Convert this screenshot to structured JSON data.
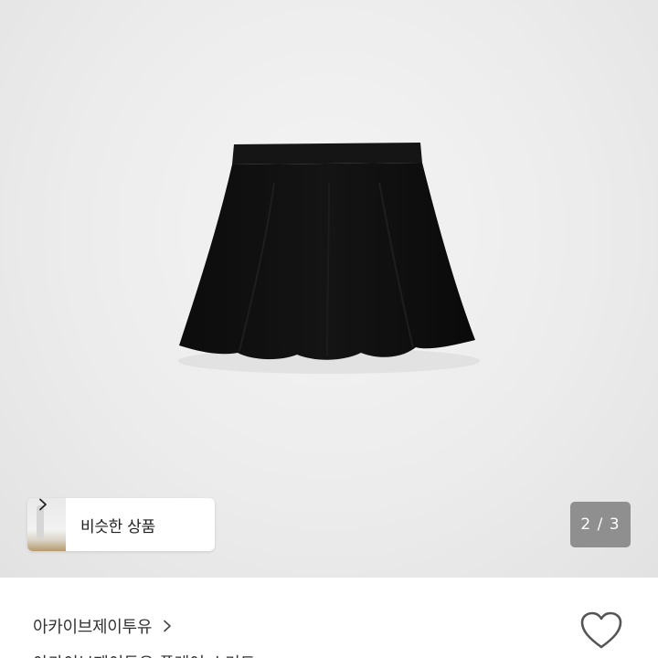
{
  "product_gallery": {
    "similar_products_label": "비슷한 상품",
    "page_indicator": "2 / 3"
  },
  "product_info": {
    "shop_name": "아카이브제이투유",
    "title_partial": "아카이브제이투유 플레어 스커트"
  },
  "icons": {
    "similar_chevron": "chevron-right-icon",
    "shop_chevron": "chevron-right-icon",
    "wishlist": "heart-outline-icon"
  },
  "colors": {
    "background": "#ffffff",
    "indicator_bg": "#6e6e6e",
    "text_primary": "#333333"
  }
}
